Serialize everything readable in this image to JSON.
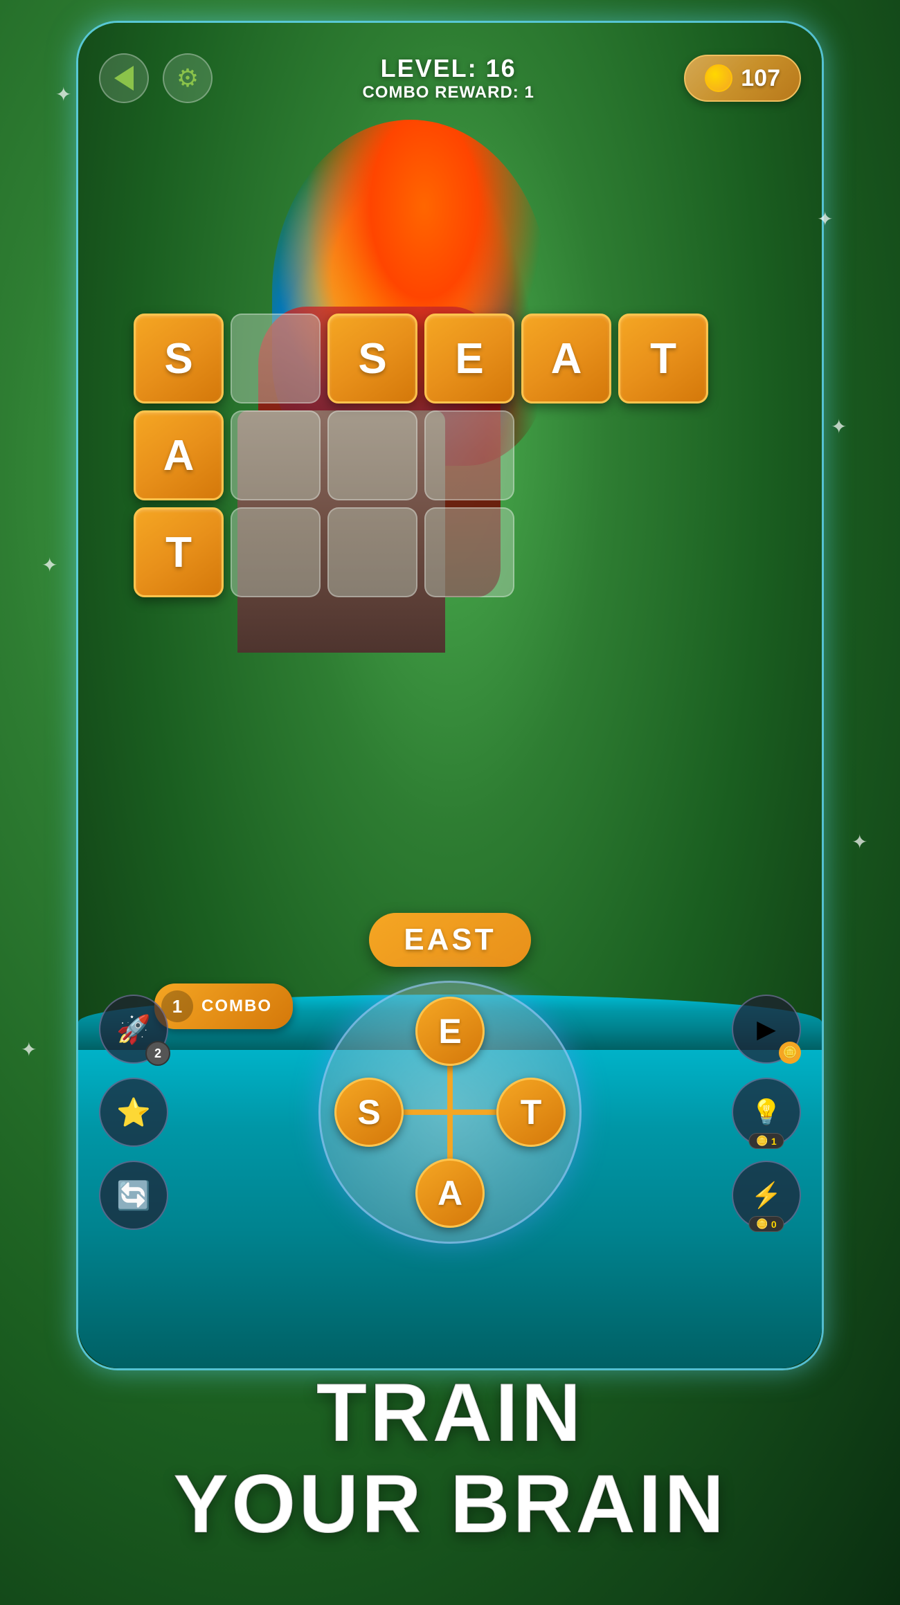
{
  "header": {
    "level_label": "LEVEL: 16",
    "combo_reward_label": "COMBO REWARD: 1",
    "coins": "107",
    "back_button_label": "back",
    "settings_label": "settings"
  },
  "grid": {
    "tiles": [
      {
        "letter": "S",
        "filled": true,
        "row": 0,
        "col": 0
      },
      {
        "letter": "",
        "filled": false,
        "row": 0,
        "col": 1
      },
      {
        "letter": "S",
        "filled": true,
        "row": 0,
        "col": 2
      },
      {
        "letter": "E",
        "filled": true,
        "row": 0,
        "col": 3
      },
      {
        "letter": "A",
        "filled": true,
        "row": 0,
        "col": 4
      },
      {
        "letter": "T",
        "filled": true,
        "row": 0,
        "col": 5
      },
      {
        "letter": "A",
        "filled": true,
        "row": 1,
        "col": 0
      },
      {
        "letter": "",
        "filled": false,
        "row": 1,
        "col": 1
      },
      {
        "letter": "",
        "filled": false,
        "row": 1,
        "col": 2
      },
      {
        "letter": "",
        "filled": false,
        "row": 1,
        "col": 3
      },
      {
        "letter": "T",
        "filled": true,
        "row": 2,
        "col": 0
      },
      {
        "letter": "",
        "filled": false,
        "row": 2,
        "col": 1
      },
      {
        "letter": "",
        "filled": false,
        "row": 2,
        "col": 2
      },
      {
        "letter": "",
        "filled": false,
        "row": 2,
        "col": 3
      }
    ]
  },
  "current_word": "EAST",
  "wheel": {
    "letters": {
      "top": "E",
      "right": "T",
      "bottom": "A",
      "left": "S"
    }
  },
  "combo": {
    "count": "1",
    "label": "COMBO"
  },
  "power_buttons": [
    {
      "icon": "🚀",
      "badge": "2",
      "name": "rocket"
    },
    {
      "icon": "⭐",
      "badge": null,
      "name": "star"
    },
    {
      "icon": "🔄",
      "badge": null,
      "name": "shuffle"
    }
  ],
  "right_buttons": [
    {
      "icon": "▶",
      "badge": null,
      "name": "video-coins"
    },
    {
      "icon": "💡",
      "badge": "1",
      "name": "hint"
    },
    {
      "icon": "⚡",
      "badge": "0",
      "name": "lightning"
    }
  ],
  "tagline": {
    "line1": "TRAIN",
    "line2": "YOUR BRAIN"
  }
}
